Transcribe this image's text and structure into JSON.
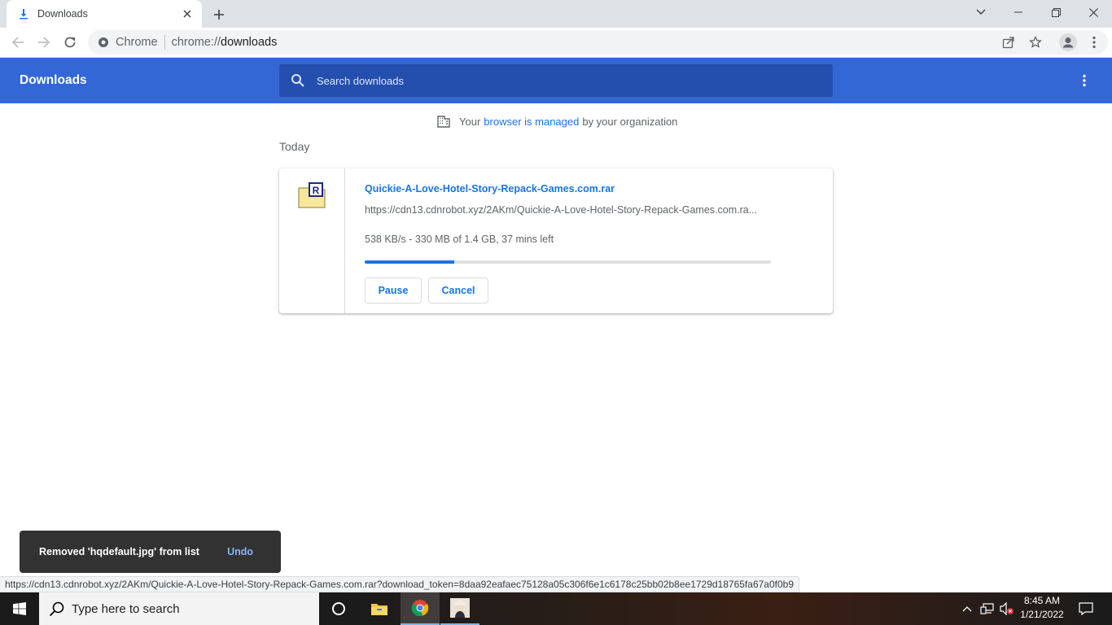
{
  "tab": {
    "title": "Downloads",
    "favicon": "download-icon"
  },
  "omnibox": {
    "chip": "Chrome",
    "url_scheme": "chrome://",
    "url_host": "downloads"
  },
  "header": {
    "title": "Downloads",
    "search_placeholder": "Search downloads"
  },
  "managed": {
    "prefix": "Your",
    "link": "browser is managed",
    "suffix": "by your organization"
  },
  "section": {
    "title": "Today"
  },
  "download": {
    "file_name": "Quickie-A-Love-Hotel-Story-Repack-Games.com.rar",
    "url": "https://cdn13.cdnrobot.xyz/2AKm/Quickie-A-Love-Hotel-Story-Repack-Games.com.ra...",
    "status": "538 KB/s - 330 MB of 1.4 GB, 37 mins left",
    "progress_percent": 22,
    "pause_label": "Pause",
    "cancel_label": "Cancel",
    "icon_letter": "R"
  },
  "toast": {
    "message": "Removed 'hqdefault.jpg' from list",
    "undo_label": "Undo"
  },
  "status_url": "https://cdn13.cdnrobot.xyz/2AKm/Quickie-A-Love-Hotel-Story-Repack-Games.com.rar?download_token=8daa92eafaec75128a05c306f6e1c6178c25bb02b8ee1729d18765fa67a0f0b9",
  "taskbar": {
    "search_placeholder": "Type here to search",
    "time": "8:45 AM",
    "date": "1/21/2022"
  },
  "colors": {
    "header_blue": "#3367d6",
    "accent": "#1a73e8",
    "toast_bg": "#323232"
  }
}
